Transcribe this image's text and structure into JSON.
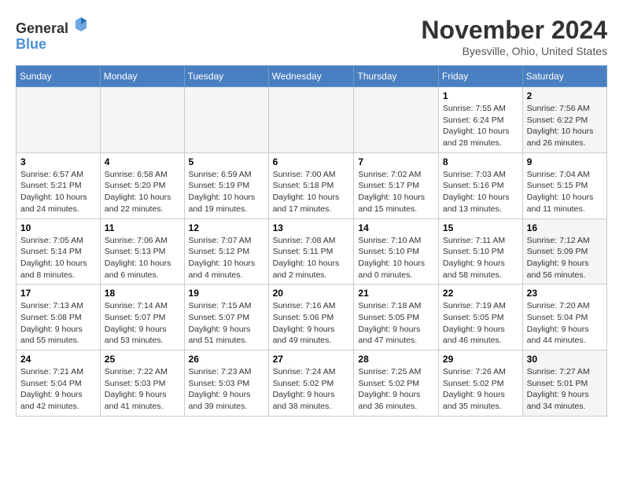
{
  "header": {
    "logo_line1": "General",
    "logo_line2": "Blue",
    "month_title": "November 2024",
    "location": "Byesville, Ohio, United States"
  },
  "weekdays": [
    "Sunday",
    "Monday",
    "Tuesday",
    "Wednesday",
    "Thursday",
    "Friday",
    "Saturday"
  ],
  "weeks": [
    [
      {
        "day": "",
        "sunrise": "",
        "sunset": "",
        "daylight": ""
      },
      {
        "day": "",
        "sunrise": "",
        "sunset": "",
        "daylight": ""
      },
      {
        "day": "",
        "sunrise": "",
        "sunset": "",
        "daylight": ""
      },
      {
        "day": "",
        "sunrise": "",
        "sunset": "",
        "daylight": ""
      },
      {
        "day": "",
        "sunrise": "",
        "sunset": "",
        "daylight": ""
      },
      {
        "day": "1",
        "sunrise": "Sunrise: 7:55 AM",
        "sunset": "Sunset: 6:24 PM",
        "daylight": "Daylight: 10 hours and 28 minutes."
      },
      {
        "day": "2",
        "sunrise": "Sunrise: 7:56 AM",
        "sunset": "Sunset: 6:22 PM",
        "daylight": "Daylight: 10 hours and 26 minutes."
      }
    ],
    [
      {
        "day": "3",
        "sunrise": "Sunrise: 6:57 AM",
        "sunset": "Sunset: 5:21 PM",
        "daylight": "Daylight: 10 hours and 24 minutes."
      },
      {
        "day": "4",
        "sunrise": "Sunrise: 6:58 AM",
        "sunset": "Sunset: 5:20 PM",
        "daylight": "Daylight: 10 hours and 22 minutes."
      },
      {
        "day": "5",
        "sunrise": "Sunrise: 6:59 AM",
        "sunset": "Sunset: 5:19 PM",
        "daylight": "Daylight: 10 hours and 19 minutes."
      },
      {
        "day": "6",
        "sunrise": "Sunrise: 7:00 AM",
        "sunset": "Sunset: 5:18 PM",
        "daylight": "Daylight: 10 hours and 17 minutes."
      },
      {
        "day": "7",
        "sunrise": "Sunrise: 7:02 AM",
        "sunset": "Sunset: 5:17 PM",
        "daylight": "Daylight: 10 hours and 15 minutes."
      },
      {
        "day": "8",
        "sunrise": "Sunrise: 7:03 AM",
        "sunset": "Sunset: 5:16 PM",
        "daylight": "Daylight: 10 hours and 13 minutes."
      },
      {
        "day": "9",
        "sunrise": "Sunrise: 7:04 AM",
        "sunset": "Sunset: 5:15 PM",
        "daylight": "Daylight: 10 hours and 11 minutes."
      }
    ],
    [
      {
        "day": "10",
        "sunrise": "Sunrise: 7:05 AM",
        "sunset": "Sunset: 5:14 PM",
        "daylight": "Daylight: 10 hours and 8 minutes."
      },
      {
        "day": "11",
        "sunrise": "Sunrise: 7:06 AM",
        "sunset": "Sunset: 5:13 PM",
        "daylight": "Daylight: 10 hours and 6 minutes."
      },
      {
        "day": "12",
        "sunrise": "Sunrise: 7:07 AM",
        "sunset": "Sunset: 5:12 PM",
        "daylight": "Daylight: 10 hours and 4 minutes."
      },
      {
        "day": "13",
        "sunrise": "Sunrise: 7:08 AM",
        "sunset": "Sunset: 5:11 PM",
        "daylight": "Daylight: 10 hours and 2 minutes."
      },
      {
        "day": "14",
        "sunrise": "Sunrise: 7:10 AM",
        "sunset": "Sunset: 5:10 PM",
        "daylight": "Daylight: 10 hours and 0 minutes."
      },
      {
        "day": "15",
        "sunrise": "Sunrise: 7:11 AM",
        "sunset": "Sunset: 5:10 PM",
        "daylight": "Daylight: 9 hours and 58 minutes."
      },
      {
        "day": "16",
        "sunrise": "Sunrise: 7:12 AM",
        "sunset": "Sunset: 5:09 PM",
        "daylight": "Daylight: 9 hours and 56 minutes."
      }
    ],
    [
      {
        "day": "17",
        "sunrise": "Sunrise: 7:13 AM",
        "sunset": "Sunset: 5:08 PM",
        "daylight": "Daylight: 9 hours and 55 minutes."
      },
      {
        "day": "18",
        "sunrise": "Sunrise: 7:14 AM",
        "sunset": "Sunset: 5:07 PM",
        "daylight": "Daylight: 9 hours and 53 minutes."
      },
      {
        "day": "19",
        "sunrise": "Sunrise: 7:15 AM",
        "sunset": "Sunset: 5:07 PM",
        "daylight": "Daylight: 9 hours and 51 minutes."
      },
      {
        "day": "20",
        "sunrise": "Sunrise: 7:16 AM",
        "sunset": "Sunset: 5:06 PM",
        "daylight": "Daylight: 9 hours and 49 minutes."
      },
      {
        "day": "21",
        "sunrise": "Sunrise: 7:18 AM",
        "sunset": "Sunset: 5:05 PM",
        "daylight": "Daylight: 9 hours and 47 minutes."
      },
      {
        "day": "22",
        "sunrise": "Sunrise: 7:19 AM",
        "sunset": "Sunset: 5:05 PM",
        "daylight": "Daylight: 9 hours and 46 minutes."
      },
      {
        "day": "23",
        "sunrise": "Sunrise: 7:20 AM",
        "sunset": "Sunset: 5:04 PM",
        "daylight": "Daylight: 9 hours and 44 minutes."
      }
    ],
    [
      {
        "day": "24",
        "sunrise": "Sunrise: 7:21 AM",
        "sunset": "Sunset: 5:04 PM",
        "daylight": "Daylight: 9 hours and 42 minutes."
      },
      {
        "day": "25",
        "sunrise": "Sunrise: 7:22 AM",
        "sunset": "Sunset: 5:03 PM",
        "daylight": "Daylight: 9 hours and 41 minutes."
      },
      {
        "day": "26",
        "sunrise": "Sunrise: 7:23 AM",
        "sunset": "Sunset: 5:03 PM",
        "daylight": "Daylight: 9 hours and 39 minutes."
      },
      {
        "day": "27",
        "sunrise": "Sunrise: 7:24 AM",
        "sunset": "Sunset: 5:02 PM",
        "daylight": "Daylight: 9 hours and 38 minutes."
      },
      {
        "day": "28",
        "sunrise": "Sunrise: 7:25 AM",
        "sunset": "Sunset: 5:02 PM",
        "daylight": "Daylight: 9 hours and 36 minutes."
      },
      {
        "day": "29",
        "sunrise": "Sunrise: 7:26 AM",
        "sunset": "Sunset: 5:02 PM",
        "daylight": "Daylight: 9 hours and 35 minutes."
      },
      {
        "day": "30",
        "sunrise": "Sunrise: 7:27 AM",
        "sunset": "Sunset: 5:01 PM",
        "daylight": "Daylight: 9 hours and 34 minutes."
      }
    ]
  ]
}
